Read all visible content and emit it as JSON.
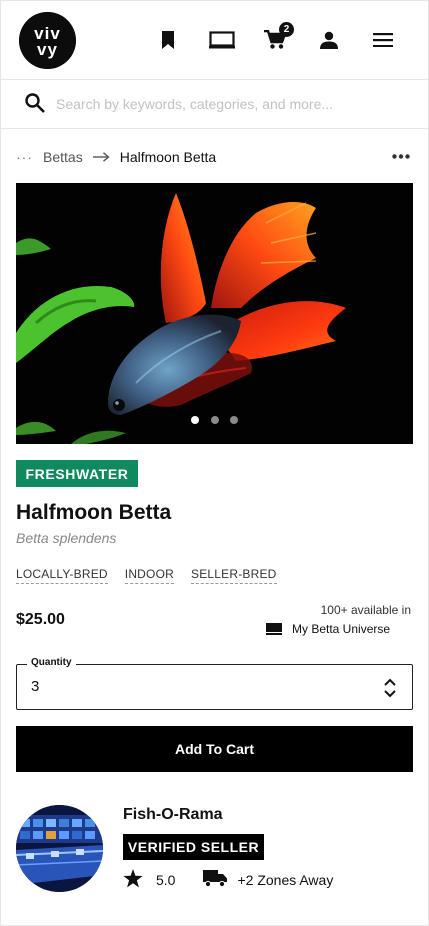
{
  "header": {
    "logo_text": "vivvy",
    "cart_count": "2",
    "icons": [
      "bookmark-icon",
      "tablet-icon",
      "cart-icon",
      "user-icon",
      "menu-icon"
    ]
  },
  "search": {
    "placeholder": "Search by keywords, categories, and more...",
    "value": ""
  },
  "breadcrumb": {
    "ellipsis": "···",
    "parent": "Bettas",
    "arrow": "→",
    "current": "Halfmoon Betta",
    "more": "•••"
  },
  "gallery": {
    "slide_count": 3,
    "active_index": 0
  },
  "product": {
    "category_badge": "FRESHWATER",
    "title": "Halfmoon Betta",
    "scientific_name": "Betta splendens",
    "tags": [
      "LOCALLY-BRED",
      "INDOOR",
      "SELLER-BRED"
    ],
    "price": "$25.00",
    "availability": "100+ available in",
    "store_name": "My Betta Universe"
  },
  "quantity": {
    "label": "Quantity",
    "value": "3"
  },
  "add_to_cart": {
    "label": "Add To Cart"
  },
  "seller": {
    "name": "Fish-O-Rama",
    "verified_label": "VERIFIED SELLER",
    "rating": "5.0",
    "distance": "+2 Zones Away"
  },
  "colors": {
    "freshwater_badge": "#0f8a5f",
    "primary_button": "#000000"
  }
}
